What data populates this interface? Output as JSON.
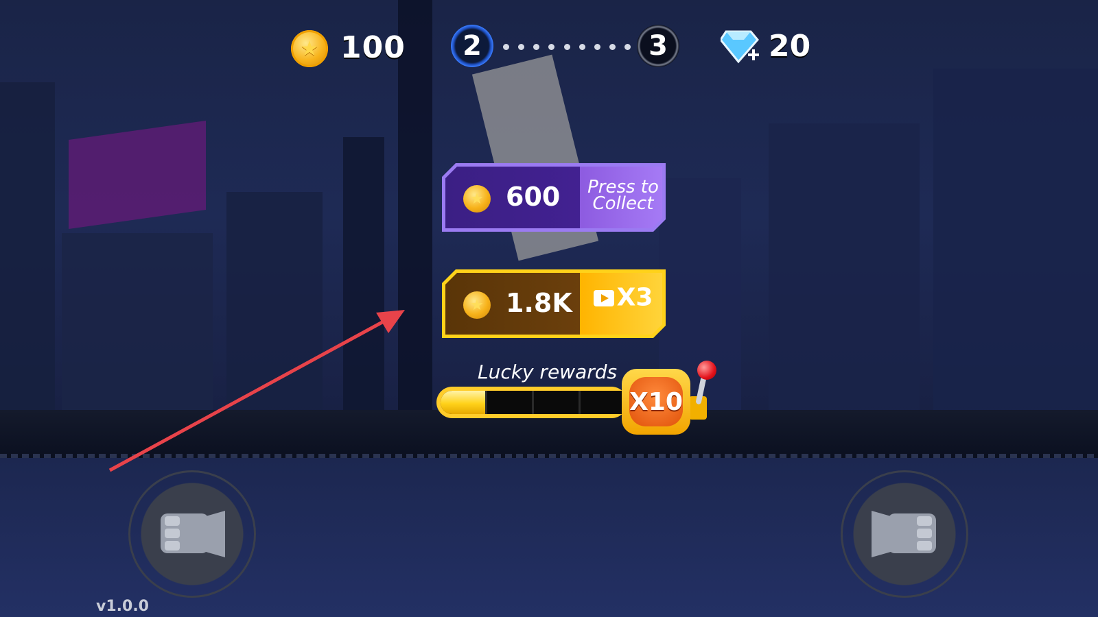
{
  "hud": {
    "coins": "100",
    "current_level": "2",
    "next_level": "3",
    "gems": "20",
    "colors": {
      "coin": "#f7b21a",
      "gem": "#5ac8ff",
      "current_level_ring": "#3a7cff"
    }
  },
  "rewards": {
    "base": {
      "amount": "600",
      "action_line1": "Press to",
      "action_line2": "Collect",
      "color": "#9b7bf2"
    },
    "ad_bonus": {
      "amount": "1.8K",
      "multiplier": "X3",
      "icon": "play-video-icon",
      "color": "#ffd21a"
    }
  },
  "lucky": {
    "label": "Lucky rewards",
    "progress_segments": 4,
    "progress_fraction": 0.25,
    "multiplier": "X10"
  },
  "controls": {
    "left": "fist-icon",
    "right": "fist-icon"
  },
  "version": "v1.0.0",
  "annotation": {
    "color": "#e8434a"
  }
}
